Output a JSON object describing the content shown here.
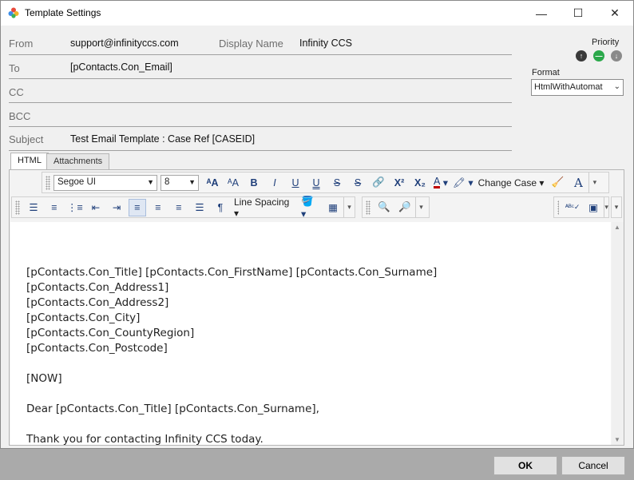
{
  "window": {
    "title": "Template Settings",
    "controls": {
      "minimize": "—",
      "maximize": "☐",
      "close": "✕"
    }
  },
  "email": {
    "from_label": "From",
    "from_value": "support@infinityccs.com",
    "display_name_label": "Display Name",
    "display_name_value": "Infinity CCS",
    "to_label": "To",
    "to_value": "[pContacts.Con_Email]",
    "cc_label": "CC",
    "cc_value": "",
    "bcc_label": "BCC",
    "bcc_value": "",
    "subject_label": "Subject",
    "subject_value": "Test Email Template : Case Ref [CASEID]"
  },
  "priority": {
    "label": "Priority",
    "icons": [
      "arrow-up-icon",
      "minus-icon",
      "arrow-down-icon"
    ],
    "colors": {
      "up": "#3a3a3a",
      "normal": "#2aa84a",
      "down": "#8a8a8a"
    }
  },
  "format": {
    "label": "Format",
    "value": "HtmlWithAutomat"
  },
  "tabs": [
    {
      "label": "HTML",
      "active": true
    },
    {
      "label": "Attachments",
      "active": false
    }
  ],
  "toolbar1": {
    "font": "Segoe UI",
    "size": "8",
    "buttons": [
      "A",
      "A",
      "B",
      "I",
      "U",
      "U",
      "S",
      "S",
      "X²",
      "X₂",
      "A"
    ],
    "change_case": "Change Case",
    "grow_font": "ᴬA",
    "shrink_font": "ᴬA"
  },
  "toolbar2": {
    "line_spacing": "Line Spacing"
  },
  "body_lines": [
    "[pContacts.Con_Title] [pContacts.Con_FirstName] [pContacts.Con_Surname]",
    "[pContacts.Con_Address1]",
    "[pContacts.Con_Address2]",
    "[pContacts.Con_City]",
    "[pContacts.Con_CountyRegion]",
    "[pContacts.Con_Postcode]",
    "",
    "[NOW]",
    "",
    "Dear [pContacts.Con_Title] [pContacts.Con_Surname],",
    "",
    "Thank you for contacting Infinity CCS today."
  ],
  "buttons": {
    "ok": "OK",
    "cancel": "Cancel"
  }
}
